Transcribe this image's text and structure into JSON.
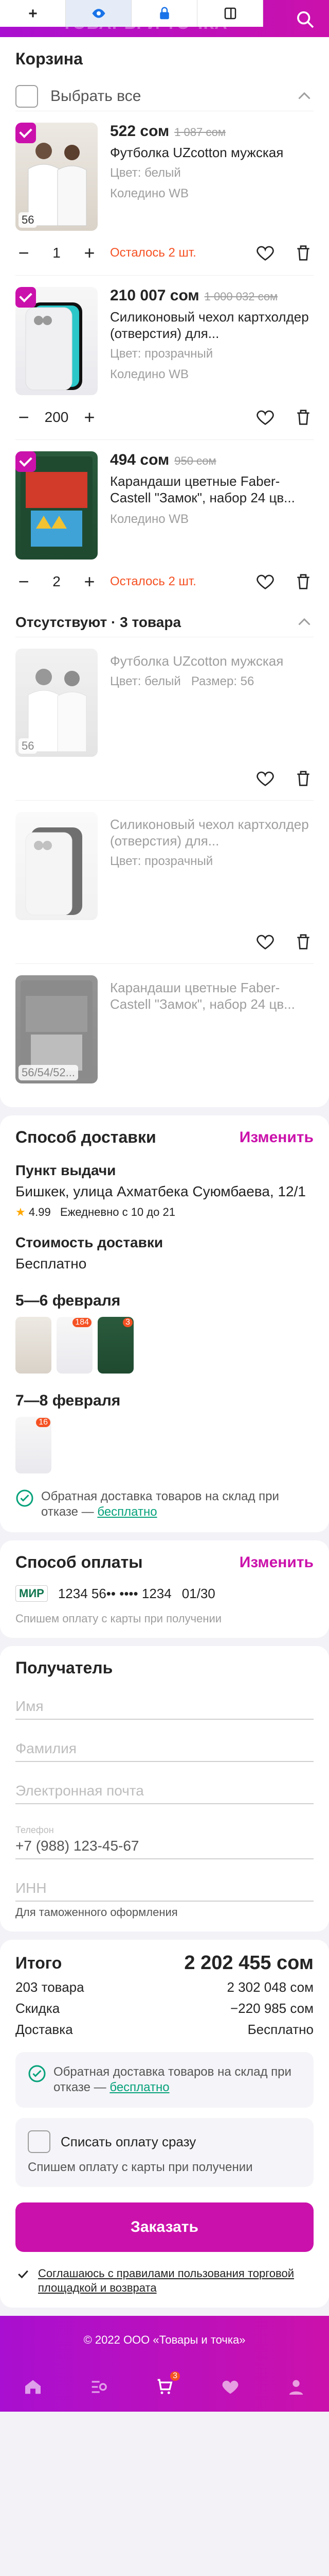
{
  "header": {
    "logo_text": "ТОВАРЫ И ТОЧКА"
  },
  "cart": {
    "title": "Корзина",
    "select_all_label": "Выбрать все",
    "items": [
      {
        "price": "522 сом",
        "old_price": "1 087 сом",
        "title": "Футболка UZcotton мужская",
        "color": "Цвет: белый",
        "warehouse": "Коледино WB",
        "size": "56",
        "qty": "1",
        "left": "Осталось 2 шт."
      },
      {
        "price": "210 007 сом",
        "old_price": "1 000 032 сом",
        "title": "Силиконовый чехол картхолдер (отверстия) для...",
        "color": "Цвет: прозрачный",
        "warehouse": "Коледино WB",
        "qty": "200",
        "left": ""
      },
      {
        "price": "494 сом",
        "old_price": "950 сом",
        "title": "Карандаши цветные Faber-Castell \"Замок\", набор 24 цв...",
        "color": "",
        "warehouse": "Коледино WB",
        "qty": "2",
        "left": "Осталось 2 шт."
      }
    ],
    "absent": {
      "title": "Отсутствуют · 3 товара",
      "items": [
        {
          "title": "Футболка UZcotton мужская",
          "color": "Цвет: белый",
          "size_label": "Размер: 56",
          "size": "56"
        },
        {
          "title": "Силиконовый чехол картхолдер (отверстия) для...",
          "color": "Цвет: прозрачный"
        },
        {
          "title": "Карандаши цветные Faber-Castell \"Замок\", набор 24 цв...",
          "size": "56/54/52..."
        }
      ]
    }
  },
  "delivery": {
    "title": "Способ доставки",
    "change": "Изменить",
    "pickup_label": "Пункт выдачи",
    "pickup_address": "Бишкек, улица Ахматбека Суюмбаева, 12/1",
    "rating": "4.99",
    "schedule": "Ежедневно с 10 до 21",
    "cost_label": "Стоимость доставки",
    "cost_value": "Бесплатно",
    "date1": "5—6 февраля",
    "date2": "7—8 февраля",
    "badge1": "184",
    "badge2": "3",
    "badge3": "16",
    "return_text": "Обратная доставка товаров на склад при отказе —",
    "return_free": "бесплатно"
  },
  "payment": {
    "title": "Способ оплаты",
    "change": "Изменить",
    "card_brand": "МИР",
    "card_number": "1234 56•• •••• 1234",
    "card_exp": "01/30",
    "note": "Спишем оплату с карты при получении"
  },
  "recipient": {
    "title": "Получатель",
    "name_ph": "Имя",
    "surname_ph": "Фамилия",
    "email_ph": "Электронная почта",
    "phone_label": "Телефон",
    "phone_value": "+7 (988) 123-45-67",
    "inn_ph": "ИНН",
    "inn_hint": "Для таможенного оформления"
  },
  "totals": {
    "title": "Итого",
    "total": "2 202 455 сом",
    "goods_label": "203 товара",
    "goods_value": "2 302 048 сом",
    "discount_label": "Скидка",
    "discount_value": "−220 985 сом",
    "delivery_label": "Доставка",
    "delivery_value": "Бесплатно",
    "return_text": "Обратная доставка товаров на склад при отказе —",
    "return_free": "бесплатно",
    "pay_now_label": "Списать оплату сразу",
    "pay_now_note": "Спишем оплату с карты при получении",
    "order_button": "Заказать",
    "agree_text": "Соглашаюсь с правилами пользования торговой площадкой и возврата"
  },
  "footer": {
    "copyright": "© 2022 ООО «Товары и точка»",
    "cart_count": "3"
  },
  "colors": {
    "accent": "#cb11ab",
    "warning": "#f55123",
    "success": "#06a27b"
  }
}
